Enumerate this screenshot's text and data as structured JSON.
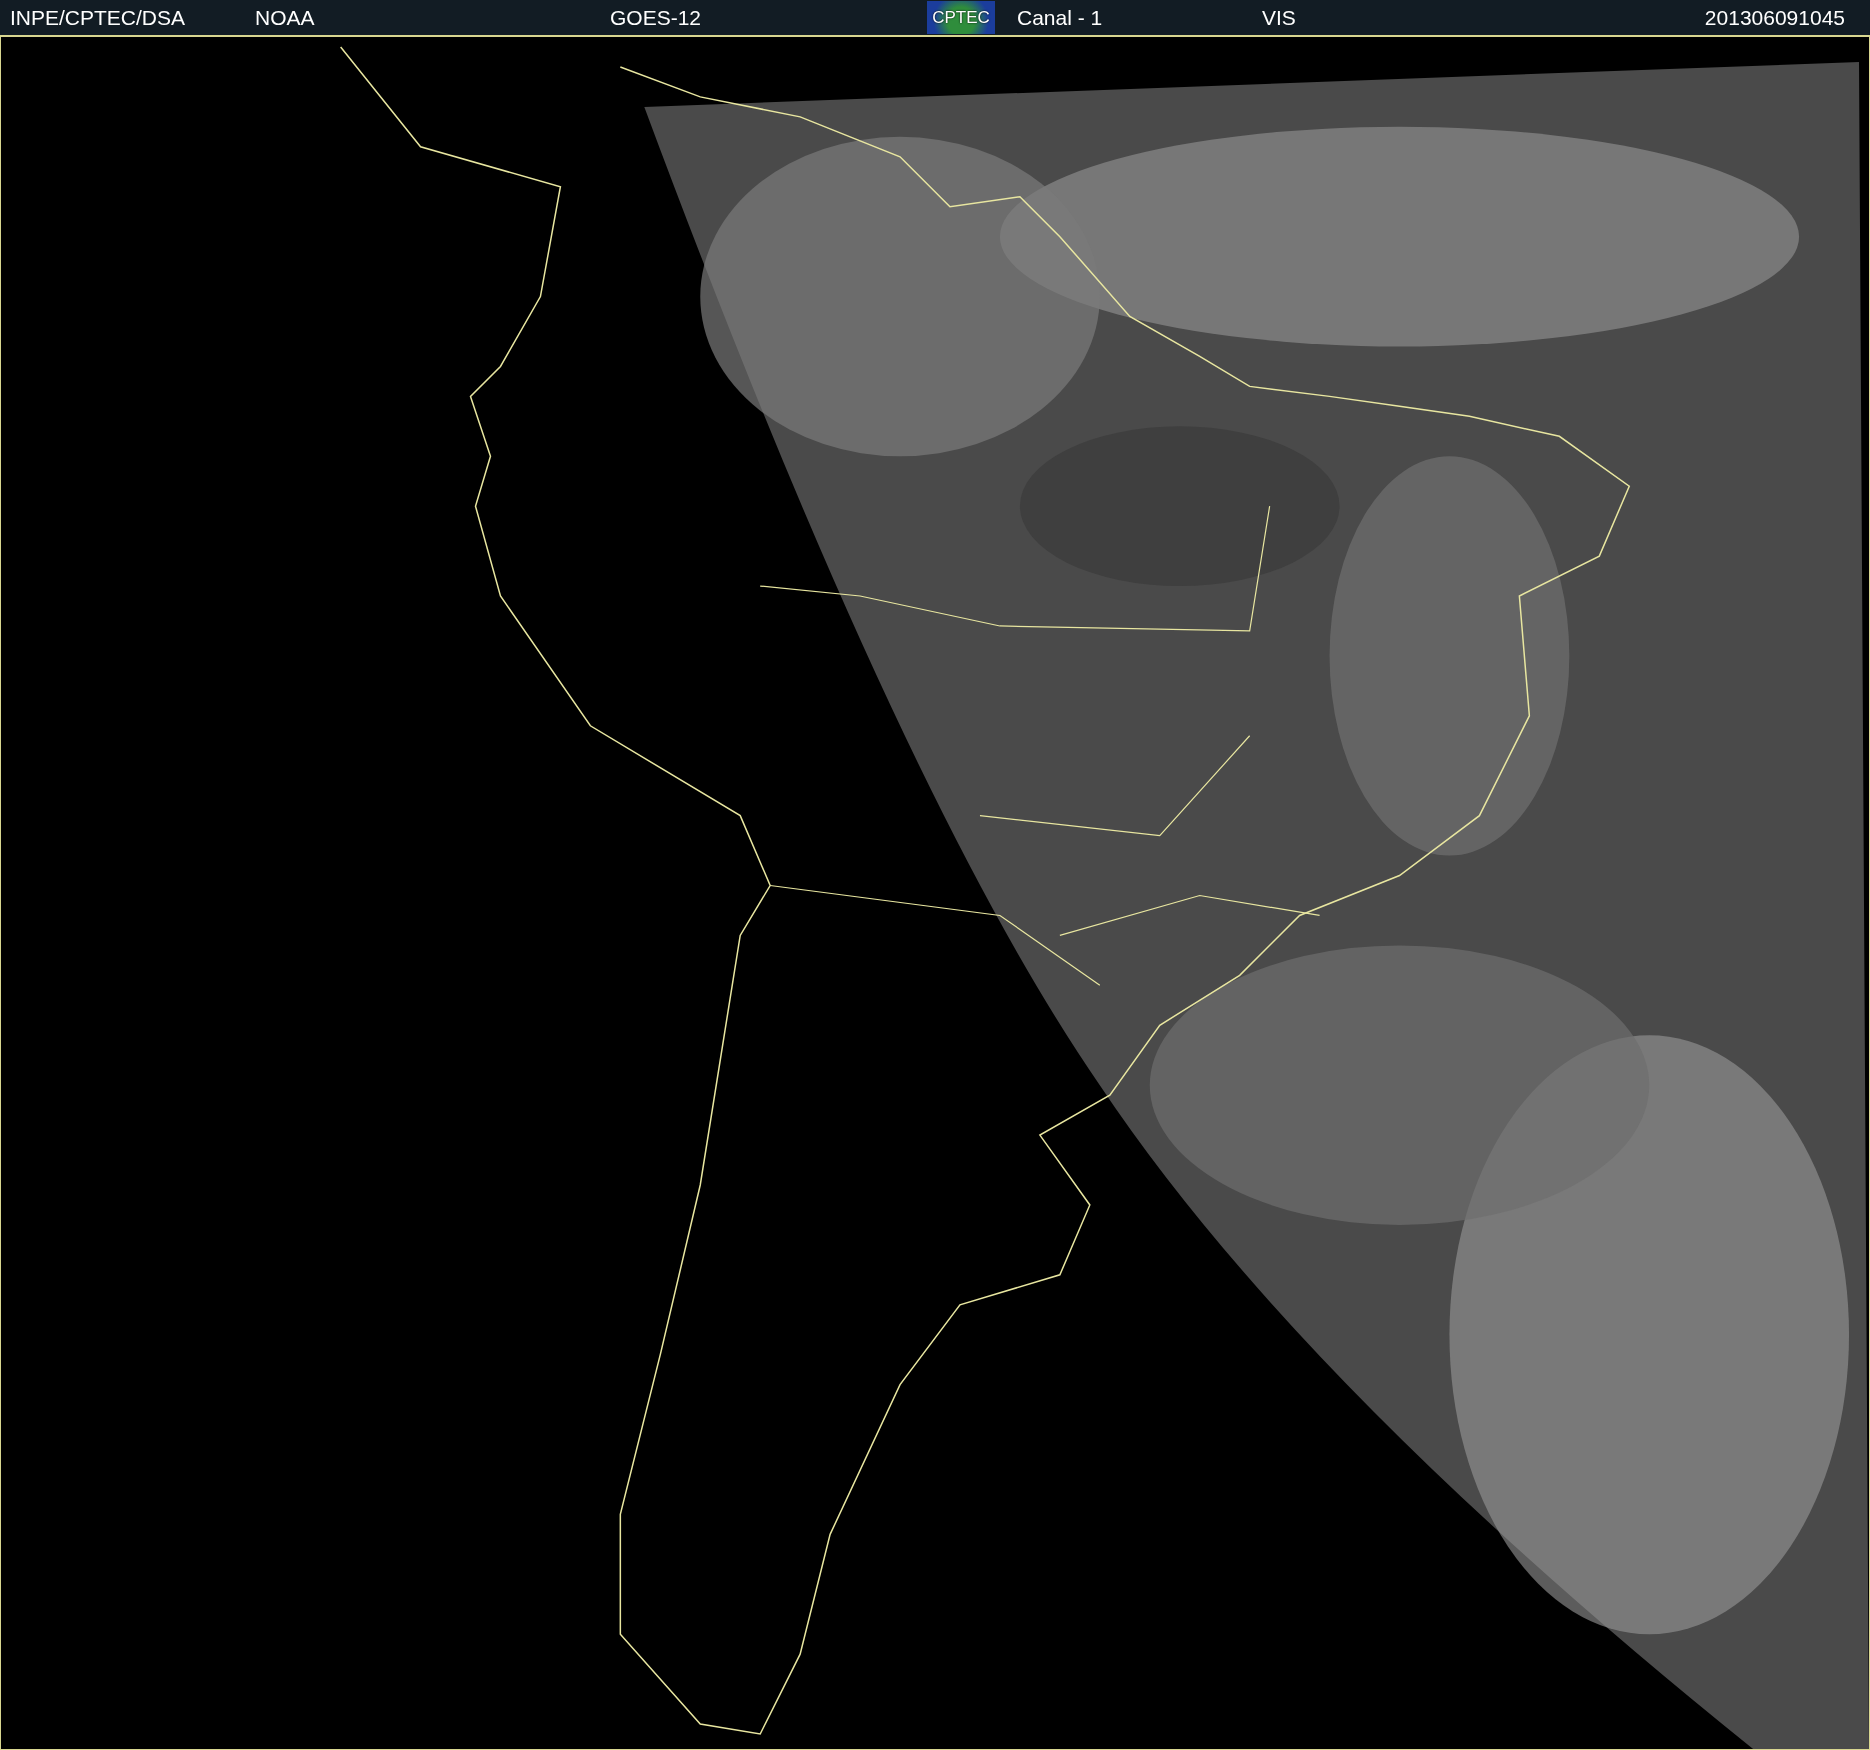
{
  "header": {
    "source": "INPE/CPTEC/DSA",
    "agency": "NOAA",
    "satellite": "GOES-12",
    "logo_text": "CPTEC",
    "channel": "Canal - 1",
    "band": "VIS",
    "timestamp": "201306091045"
  }
}
